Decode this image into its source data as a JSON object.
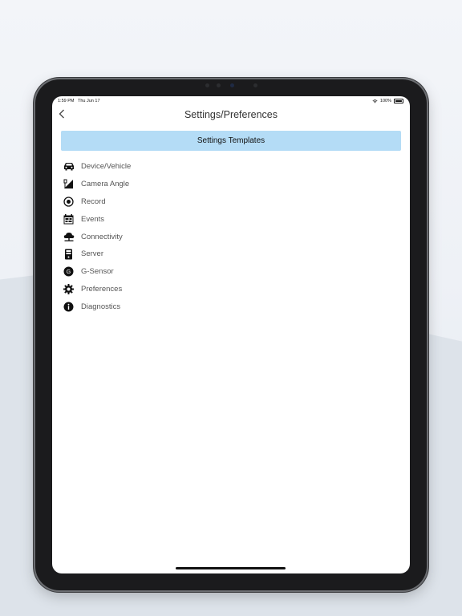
{
  "status_bar": {
    "time": "1:59 PM",
    "date": "Thu Jun 17",
    "battery": "100%"
  },
  "nav": {
    "title": "Settings/Preferences"
  },
  "templates_button": {
    "label": "Settings Templates"
  },
  "menu": {
    "items": [
      {
        "label": "Device/Vehicle",
        "icon": "car-icon"
      },
      {
        "label": "Camera Angle",
        "icon": "camera-angle-icon"
      },
      {
        "label": "Record",
        "icon": "record-icon"
      },
      {
        "label": "Events",
        "icon": "calendar-icon"
      },
      {
        "label": "Connectivity",
        "icon": "cloud-icon"
      },
      {
        "label": "Server",
        "icon": "server-icon"
      },
      {
        "label": "G-Sensor",
        "icon": "g-sensor-icon"
      },
      {
        "label": "Preferences",
        "icon": "gear-icon"
      },
      {
        "label": "Diagnostics",
        "icon": "info-icon"
      }
    ]
  },
  "colors": {
    "accent": "#b4dcf6",
    "text": "#555555",
    "title": "#333333"
  }
}
